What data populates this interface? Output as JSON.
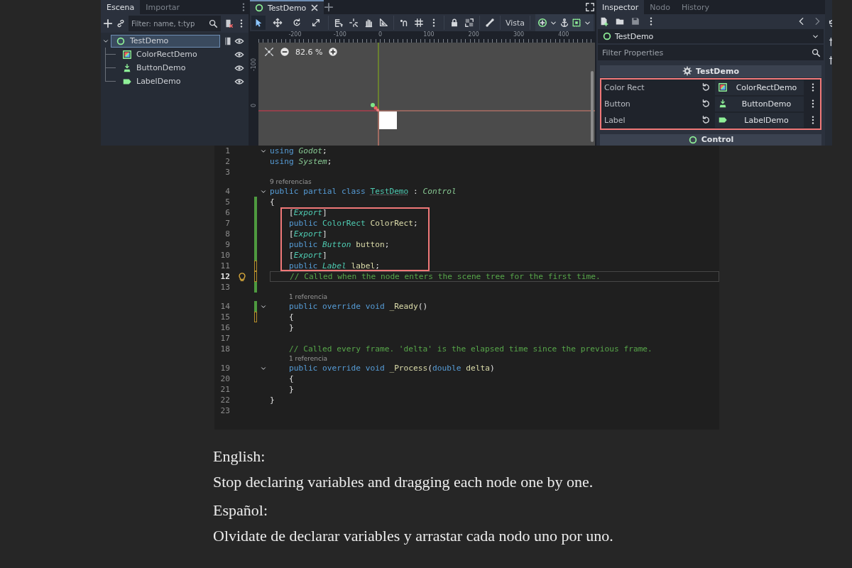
{
  "scene_dock": {
    "tabs": [
      {
        "label": "Escena",
        "selected": true
      },
      {
        "label": "Importar",
        "selected": false
      }
    ],
    "filter": {
      "placeholder": "Filter: name, t:typ"
    },
    "tree": [
      {
        "label": "TestDemo",
        "kind": "control",
        "selected": true,
        "has_script": true,
        "visible": true,
        "children": [
          {
            "label": "ColorRectDemo",
            "kind": "colorrect",
            "selected": false,
            "has_script": false,
            "visible": true
          },
          {
            "label": "ButtonDemo",
            "kind": "button",
            "selected": false,
            "has_script": false,
            "visible": true
          },
          {
            "label": "LabelDemo",
            "kind": "label",
            "selected": false,
            "has_script": false,
            "visible": true
          }
        ]
      }
    ]
  },
  "editor": {
    "tabs": [
      {
        "label": "TestDemo",
        "selected": true
      }
    ],
    "tools": [
      {
        "kind": "select",
        "selected": true
      },
      {
        "kind": "move",
        "selected": false
      },
      {
        "kind": "rotate",
        "selected": false
      },
      {
        "kind": "scale",
        "selected": false
      }
    ],
    "view_menu": "Vista",
    "ruler": [
      "-200",
      "-100",
      "0",
      "100",
      "200",
      "300",
      "400"
    ],
    "vruler": [
      "-100",
      "0"
    ],
    "zoom": "82.6 %"
  },
  "inspector": {
    "tabs": [
      {
        "label": "Inspector",
        "selected": true
      },
      {
        "label": "Nodo",
        "selected": false
      },
      {
        "label": "History",
        "selected": false
      }
    ],
    "node": {
      "label": "TestDemo",
      "kind": "control"
    },
    "filter": {
      "placeholder": "Filter Properties"
    },
    "sections": [
      {
        "title": "TestDemo",
        "kind": "script",
        "properties": [
          {
            "name": "Color Rect",
            "value": "ColorRectDemo",
            "kind": "colorrect"
          },
          {
            "name": "Button",
            "value": "ButtonDemo",
            "kind": "button"
          },
          {
            "name": "Label",
            "value": "LabelDemo",
            "kind": "label"
          }
        ]
      },
      {
        "title": "Control",
        "kind": "control"
      }
    ]
  },
  "code": {
    "lines": [
      {
        "kind": "line",
        "number": "1",
        "foldable": true,
        "saved_change": false,
        "unsaved_change": false,
        "current": false,
        "highlighted": false,
        "tokens": [
          {
            "text": "using ",
            "kind": "keyword"
          },
          {
            "text": "Godot",
            "kind": "namespace"
          },
          {
            "text": ";",
            "kind": "punct"
          }
        ]
      },
      {
        "kind": "line",
        "number": "2",
        "foldable": false,
        "saved_change": false,
        "unsaved_change": false,
        "current": false,
        "highlighted": false,
        "tokens": [
          {
            "text": "using ",
            "kind": "keyword"
          },
          {
            "text": "System",
            "kind": "namespace"
          },
          {
            "text": ";",
            "kind": "punct"
          }
        ]
      },
      {
        "kind": "line",
        "number": "3",
        "foldable": false,
        "saved_change": false,
        "unsaved_change": false,
        "current": false,
        "highlighted": false
      },
      {
        "kind": "codelens",
        "text": "9 referencias"
      },
      {
        "kind": "line",
        "number": "4",
        "foldable": true,
        "saved_change": false,
        "unsaved_change": false,
        "current": false,
        "highlighted": false,
        "tokens": [
          {
            "text": "public partial class ",
            "kind": "keyword"
          },
          {
            "text": "TestDemo",
            "kind": "class"
          },
          {
            "text": " : ",
            "kind": "punct"
          },
          {
            "text": "Control",
            "kind": "namespace"
          }
        ]
      },
      {
        "kind": "line",
        "number": "5",
        "foldable": false,
        "saved_change": true,
        "unsaved_change": false,
        "current": false,
        "highlighted": false,
        "tokens": [
          {
            "text": "{",
            "kind": "punct"
          }
        ]
      },
      {
        "kind": "line",
        "number": "6",
        "foldable": false,
        "saved_change": true,
        "unsaved_change": false,
        "current": false,
        "highlighted": true,
        "tokens": [
          {
            "text": "    [",
            "kind": "punct"
          },
          {
            "text": "Export",
            "kind": "attribute"
          },
          {
            "text": "]",
            "kind": "punct"
          }
        ]
      },
      {
        "kind": "line",
        "number": "7",
        "foldable": false,
        "saved_change": true,
        "unsaved_change": false,
        "current": false,
        "highlighted": true,
        "tokens": [
          {
            "text": "    public ",
            "kind": "keyword"
          },
          {
            "text": "ColorRect ",
            "kind": "type"
          },
          {
            "text": "ColorRect",
            "kind": "field"
          },
          {
            "text": ";",
            "kind": "punct"
          }
        ]
      },
      {
        "kind": "line",
        "number": "8",
        "foldable": false,
        "saved_change": true,
        "unsaved_change": false,
        "current": false,
        "highlighted": true,
        "tokens": [
          {
            "text": "    [",
            "kind": "punct"
          },
          {
            "text": "Export",
            "kind": "attribute"
          },
          {
            "text": "]",
            "kind": "punct"
          }
        ]
      },
      {
        "kind": "line",
        "number": "9",
        "foldable": false,
        "saved_change": true,
        "unsaved_change": false,
        "current": false,
        "highlighted": true,
        "tokens": [
          {
            "text": "    public ",
            "kind": "keyword"
          },
          {
            "text": "Button ",
            "kind": "type-italic"
          },
          {
            "text": "button",
            "kind": "field"
          },
          {
            "text": ";",
            "kind": "punct"
          }
        ]
      },
      {
        "kind": "line",
        "number": "10",
        "foldable": false,
        "saved_change": true,
        "unsaved_change": false,
        "current": false,
        "highlighted": true,
        "tokens": [
          {
            "text": "    [",
            "kind": "punct"
          },
          {
            "text": "Export",
            "kind": "attribute"
          },
          {
            "text": "]",
            "kind": "punct"
          }
        ]
      },
      {
        "kind": "line",
        "number": "11",
        "foldable": false,
        "saved_change": false,
        "unsaved_change": true,
        "current": false,
        "highlighted": true,
        "tokens": [
          {
            "text": "    public ",
            "kind": "keyword"
          },
          {
            "text": "Label ",
            "kind": "type-italic"
          },
          {
            "text": "label",
            "kind": "field"
          },
          {
            "text": ";",
            "kind": "punct"
          }
        ]
      },
      {
        "kind": "line",
        "number": "12",
        "foldable": false,
        "saved_change": false,
        "unsaved_change": true,
        "current": true,
        "highlighted": false,
        "tokens": [
          {
            "text": "    // Called when the node enters the scene tree for the first time.",
            "kind": "comment"
          }
        ]
      },
      {
        "kind": "line",
        "number": "13",
        "foldable": false,
        "saved_change": true,
        "unsaved_change": false,
        "current": false,
        "highlighted": false
      },
      {
        "kind": "codelens",
        "text": "    1 referencia"
      },
      {
        "kind": "line",
        "number": "14",
        "foldable": true,
        "saved_change": true,
        "unsaved_change": false,
        "current": false,
        "highlighted": false,
        "tokens": [
          {
            "text": "    public override void ",
            "kind": "keyword"
          },
          {
            "text": "_Ready",
            "kind": "method"
          },
          {
            "text": "()",
            "kind": "punct"
          }
        ]
      },
      {
        "kind": "line",
        "number": "15",
        "foldable": false,
        "saved_change": false,
        "unsaved_change": true,
        "current": false,
        "highlighted": false,
        "tokens": [
          {
            "text": "    {",
            "kind": "punct"
          }
        ]
      },
      {
        "kind": "line",
        "number": "16",
        "foldable": false,
        "saved_change": false,
        "unsaved_change": false,
        "current": false,
        "highlighted": false,
        "tokens": [
          {
            "text": "    }",
            "kind": "punct"
          }
        ]
      },
      {
        "kind": "line",
        "number": "17",
        "foldable": false,
        "saved_change": false,
        "unsaved_change": false,
        "current": false,
        "highlighted": false
      },
      {
        "kind": "line",
        "number": "18",
        "foldable": false,
        "saved_change": false,
        "unsaved_change": false,
        "current": false,
        "highlighted": false,
        "tokens": [
          {
            "text": "    // Called every frame. 'delta' is the elapsed time since the previous frame.",
            "kind": "comment"
          }
        ]
      },
      {
        "kind": "codelens",
        "text": "    1 referencia"
      },
      {
        "kind": "line",
        "number": "19",
        "foldable": true,
        "saved_change": false,
        "unsaved_change": false,
        "current": false,
        "highlighted": false,
        "tokens": [
          {
            "text": "    public override void ",
            "kind": "keyword"
          },
          {
            "text": "_Process",
            "kind": "method"
          },
          {
            "text": "(",
            "kind": "punct"
          },
          {
            "text": "double ",
            "kind": "keyword"
          },
          {
            "text": "delta",
            "kind": "field"
          },
          {
            "text": ")",
            "kind": "punct"
          }
        ]
      },
      {
        "kind": "line",
        "number": "20",
        "foldable": false,
        "saved_change": false,
        "unsaved_change": false,
        "current": false,
        "highlighted": false,
        "tokens": [
          {
            "text": "    {",
            "kind": "punct"
          }
        ]
      },
      {
        "kind": "line",
        "number": "21",
        "foldable": false,
        "saved_change": false,
        "unsaved_change": false,
        "current": false,
        "highlighted": false,
        "tokens": [
          {
            "text": "    }",
            "kind": "punct"
          }
        ]
      },
      {
        "kind": "line",
        "number": "22",
        "foldable": false,
        "saved_change": false,
        "unsaved_change": false,
        "current": false,
        "highlighted": false,
        "tokens": [
          {
            "text": "}",
            "kind": "punct"
          }
        ]
      },
      {
        "kind": "line",
        "number": "23",
        "foldable": false,
        "saved_change": false,
        "unsaved_change": false,
        "current": false,
        "highlighted": false
      }
    ]
  },
  "captions": [
    {
      "kind": "heading",
      "text": "English:"
    },
    {
      "kind": "body",
      "text": "Stop declaring variables and dragging each node one by one."
    },
    {
      "kind": "heading",
      "text": "Español:"
    },
    {
      "kind": "body",
      "text": "Olvidate de declarar variables y arrastar cada nodo uno por uno."
    }
  ]
}
